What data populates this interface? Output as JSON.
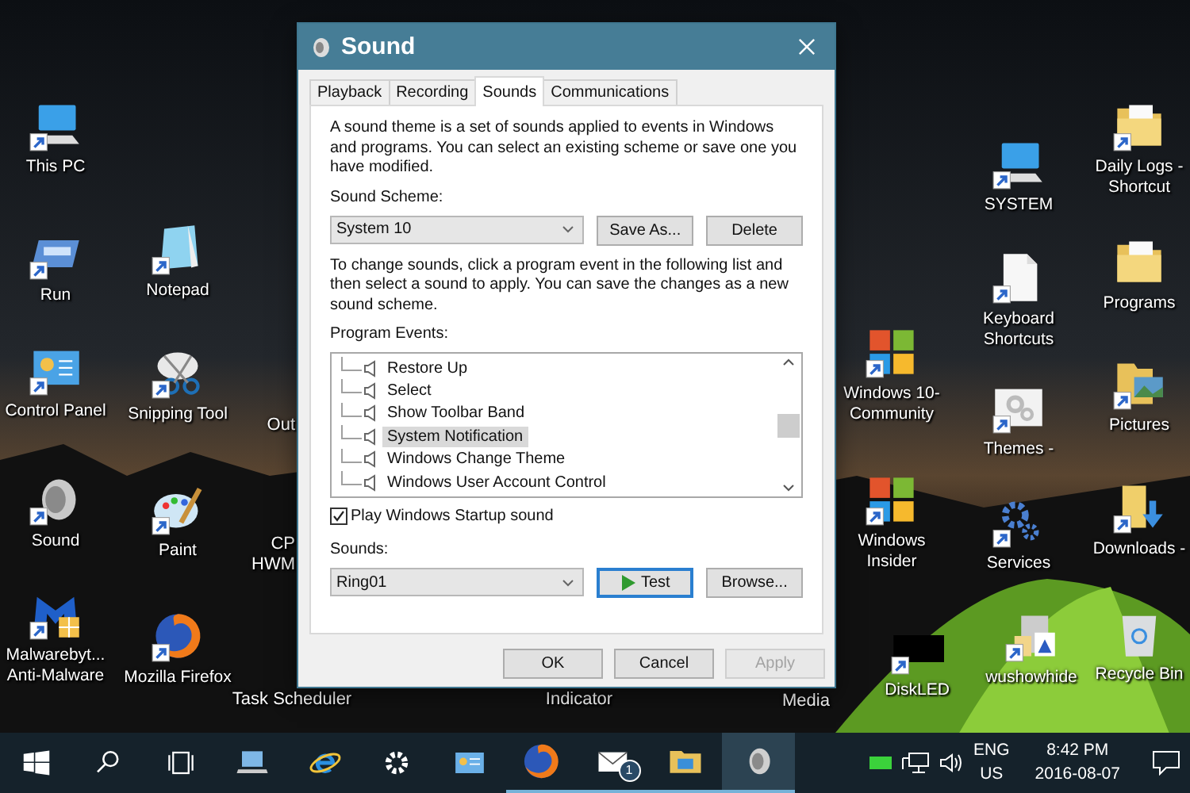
{
  "desktop_icons": [
    {
      "label": "This PC",
      "kind": "monitor",
      "shortcut": true
    },
    {
      "label": "Run",
      "kind": "run",
      "shortcut": true
    },
    {
      "label": "Control Panel",
      "kind": "panel",
      "shortcut": true
    },
    {
      "label": "Sound",
      "kind": "speaker",
      "shortcut": true
    },
    {
      "label": "Malwarebyt... Anti-Malware",
      "kind": "shield",
      "shortcut": true
    },
    {
      "label": "Notepad",
      "kind": "notepad",
      "shortcut": true
    },
    {
      "label": "Snipping Tool",
      "kind": "scissors",
      "shortcut": true
    },
    {
      "label": "Paint",
      "kind": "palette",
      "shortcut": true
    },
    {
      "label": "Mozilla Firefox",
      "kind": "firefox",
      "shortcut": true
    },
    {
      "label": "Windows 10-Community",
      "kind": "tiles",
      "shortcut": true
    },
    {
      "label": "Windows Insider",
      "kind": "tiles",
      "shortcut": true
    },
    {
      "label": "DiskLED",
      "kind": "block",
      "shortcut": true
    },
    {
      "label": "SYSTEM",
      "kind": "monitor",
      "shortcut": true
    },
    {
      "label": "Keyboard Shortcuts",
      "kind": "document",
      "shortcut": true
    },
    {
      "label": "Themes -",
      "kind": "gears",
      "shortcut": true
    },
    {
      "label": "Services",
      "kind": "cogs",
      "shortcut": true
    },
    {
      "label": "wushowhide",
      "kind": "files",
      "shortcut": true
    },
    {
      "label": "Daily Logs - Shortcut",
      "kind": "folder",
      "shortcut": true
    },
    {
      "label": "Programs",
      "kind": "folder",
      "shortcut": false
    },
    {
      "label": "Pictures",
      "kind": "folder-pictures",
      "shortcut": true
    },
    {
      "label": "Downloads -",
      "kind": "folder-download",
      "shortcut": true
    },
    {
      "label": "Recycle Bin",
      "kind": "recycle",
      "shortcut": false
    }
  ],
  "partly_hidden_icons": [
    {
      "label": "Out"
    },
    {
      "label": "CP HWM"
    },
    {
      "label": "Task Scheduler"
    },
    {
      "label": "Indicator"
    },
    {
      "label": "Media"
    }
  ],
  "dialog": {
    "title": "Sound",
    "tabs": [
      {
        "label": "Playback",
        "selected": false
      },
      {
        "label": "Recording",
        "selected": false
      },
      {
        "label": "Sounds",
        "selected": true
      },
      {
        "label": "Communications",
        "selected": false
      }
    ],
    "description": "A sound theme is a set of sounds applied to events in Windows and programs.  You can select an existing scheme or save one you have modified.",
    "scheme_label": "Sound Scheme:",
    "scheme": {
      "value": "System 10"
    },
    "scheme_buttons": [
      "Save As...",
      "Delete"
    ],
    "instructions": "To change sounds, click a program event in the following list and then select a sound to apply.  You can save the changes as a new sound scheme.",
    "events_label": "Program Events:",
    "events": [
      {
        "label": "Restore Up",
        "selected": false
      },
      {
        "label": "Select",
        "selected": false
      },
      {
        "label": "Show Toolbar Band",
        "selected": false
      },
      {
        "label": "System Notification",
        "selected": true
      },
      {
        "label": "Windows Change Theme",
        "selected": false
      },
      {
        "label": "Windows User Account Control",
        "selected": false
      }
    ],
    "startup_sound": {
      "label": "Play Windows Startup sound",
      "checked": true
    },
    "sounds_label": "Sounds:",
    "sound": {
      "value": "Ring01"
    },
    "test_button": "Test",
    "browse_button": "Browse...",
    "footer_buttons": [
      {
        "label": "OK",
        "disabled": false
      },
      {
        "label": "Cancel",
        "disabled": false
      },
      {
        "label": "Apply",
        "disabled": true
      }
    ]
  },
  "taskbar": {
    "apps": [
      {
        "kind": "start",
        "running": false,
        "selected": false
      },
      {
        "kind": "search",
        "running": false,
        "selected": false
      },
      {
        "kind": "task-view",
        "running": false,
        "selected": false
      },
      {
        "kind": "laptop",
        "running": false,
        "selected": false
      },
      {
        "kind": "ie",
        "running": false,
        "selected": false
      },
      {
        "kind": "gear",
        "running": false,
        "selected": false
      },
      {
        "kind": "panel",
        "running": false,
        "selected": false
      },
      {
        "kind": "firefox",
        "running": true,
        "selected": false
      },
      {
        "kind": "mail",
        "running": true,
        "selected": false,
        "badge": "1"
      },
      {
        "kind": "folder",
        "running": true,
        "selected": false
      },
      {
        "kind": "speaker",
        "running": true,
        "selected": true
      }
    ],
    "language": "ENG",
    "region": "US",
    "time": "8:42 PM",
    "date": "2016-08-07"
  }
}
